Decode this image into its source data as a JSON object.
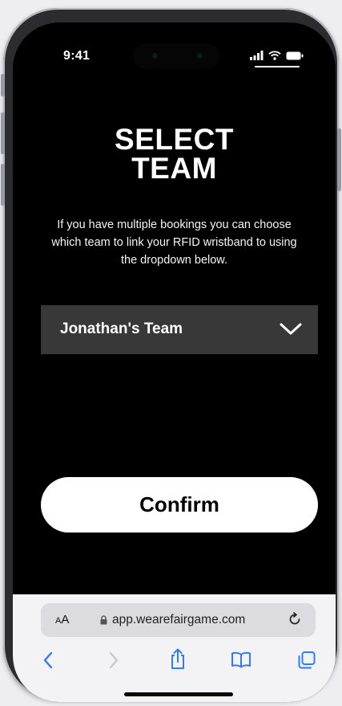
{
  "status_bar": {
    "time": "9:41"
  },
  "page": {
    "title_line1": "SELECT",
    "title_line2": "TEAM",
    "description": "If you have multiple bookings you can choose which team to link your RFID wristband to using the dropdown below."
  },
  "team_dropdown": {
    "selected": "Jonathan's Team"
  },
  "confirm_button": {
    "label": "Confirm"
  },
  "browser": {
    "aa_label_small": "A",
    "aa_label_large": "A",
    "url": "app.wearefairgame.com"
  },
  "icons": {
    "back": "chevron-left-icon",
    "forward": "chevron-right-icon",
    "share": "share-icon",
    "bookmarks": "book-icon",
    "tabs": "tabs-icon"
  },
  "colors": {
    "screen_bg": "#000000",
    "dropdown_bg": "#383838",
    "button_bg": "#ffffff",
    "browser_blue": "#2f7cf6"
  }
}
